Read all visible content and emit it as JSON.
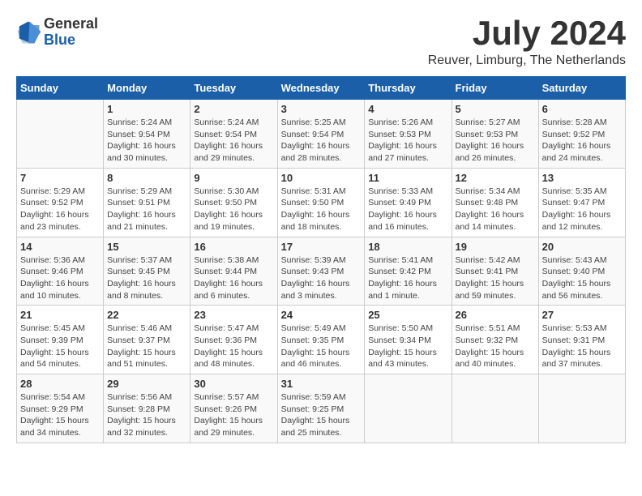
{
  "logo": {
    "general": "General",
    "blue": "Blue"
  },
  "title": {
    "month": "July 2024",
    "location": "Reuver, Limburg, The Netherlands"
  },
  "calendar": {
    "headers": [
      "Sunday",
      "Monday",
      "Tuesday",
      "Wednesday",
      "Thursday",
      "Friday",
      "Saturday"
    ],
    "weeks": [
      [
        {
          "day": "",
          "text": ""
        },
        {
          "day": "1",
          "text": "Sunrise: 5:24 AM\nSunset: 9:54 PM\nDaylight: 16 hours and 30 minutes."
        },
        {
          "day": "2",
          "text": "Sunrise: 5:24 AM\nSunset: 9:54 PM\nDaylight: 16 hours and 29 minutes."
        },
        {
          "day": "3",
          "text": "Sunrise: 5:25 AM\nSunset: 9:54 PM\nDaylight: 16 hours and 28 minutes."
        },
        {
          "day": "4",
          "text": "Sunrise: 5:26 AM\nSunset: 9:53 PM\nDaylight: 16 hours and 27 minutes."
        },
        {
          "day": "5",
          "text": "Sunrise: 5:27 AM\nSunset: 9:53 PM\nDaylight: 16 hours and 26 minutes."
        },
        {
          "day": "6",
          "text": "Sunrise: 5:28 AM\nSunset: 9:52 PM\nDaylight: 16 hours and 24 minutes."
        }
      ],
      [
        {
          "day": "7",
          "text": "Sunrise: 5:29 AM\nSunset: 9:52 PM\nDaylight: 16 hours and 23 minutes."
        },
        {
          "day": "8",
          "text": "Sunrise: 5:29 AM\nSunset: 9:51 PM\nDaylight: 16 hours and 21 minutes."
        },
        {
          "day": "9",
          "text": "Sunrise: 5:30 AM\nSunset: 9:50 PM\nDaylight: 16 hours and 19 minutes."
        },
        {
          "day": "10",
          "text": "Sunrise: 5:31 AM\nSunset: 9:50 PM\nDaylight: 16 hours and 18 minutes."
        },
        {
          "day": "11",
          "text": "Sunrise: 5:33 AM\nSunset: 9:49 PM\nDaylight: 16 hours and 16 minutes."
        },
        {
          "day": "12",
          "text": "Sunrise: 5:34 AM\nSunset: 9:48 PM\nDaylight: 16 hours and 14 minutes."
        },
        {
          "day": "13",
          "text": "Sunrise: 5:35 AM\nSunset: 9:47 PM\nDaylight: 16 hours and 12 minutes."
        }
      ],
      [
        {
          "day": "14",
          "text": "Sunrise: 5:36 AM\nSunset: 9:46 PM\nDaylight: 16 hours and 10 minutes."
        },
        {
          "day": "15",
          "text": "Sunrise: 5:37 AM\nSunset: 9:45 PM\nDaylight: 16 hours and 8 minutes."
        },
        {
          "day": "16",
          "text": "Sunrise: 5:38 AM\nSunset: 9:44 PM\nDaylight: 16 hours and 6 minutes."
        },
        {
          "day": "17",
          "text": "Sunrise: 5:39 AM\nSunset: 9:43 PM\nDaylight: 16 hours and 3 minutes."
        },
        {
          "day": "18",
          "text": "Sunrise: 5:41 AM\nSunset: 9:42 PM\nDaylight: 16 hours and 1 minute."
        },
        {
          "day": "19",
          "text": "Sunrise: 5:42 AM\nSunset: 9:41 PM\nDaylight: 15 hours and 59 minutes."
        },
        {
          "day": "20",
          "text": "Sunrise: 5:43 AM\nSunset: 9:40 PM\nDaylight: 15 hours and 56 minutes."
        }
      ],
      [
        {
          "day": "21",
          "text": "Sunrise: 5:45 AM\nSunset: 9:39 PM\nDaylight: 15 hours and 54 minutes."
        },
        {
          "day": "22",
          "text": "Sunrise: 5:46 AM\nSunset: 9:37 PM\nDaylight: 15 hours and 51 minutes."
        },
        {
          "day": "23",
          "text": "Sunrise: 5:47 AM\nSunset: 9:36 PM\nDaylight: 15 hours and 48 minutes."
        },
        {
          "day": "24",
          "text": "Sunrise: 5:49 AM\nSunset: 9:35 PM\nDaylight: 15 hours and 46 minutes."
        },
        {
          "day": "25",
          "text": "Sunrise: 5:50 AM\nSunset: 9:34 PM\nDaylight: 15 hours and 43 minutes."
        },
        {
          "day": "26",
          "text": "Sunrise: 5:51 AM\nSunset: 9:32 PM\nDaylight: 15 hours and 40 minutes."
        },
        {
          "day": "27",
          "text": "Sunrise: 5:53 AM\nSunset: 9:31 PM\nDaylight: 15 hours and 37 minutes."
        }
      ],
      [
        {
          "day": "28",
          "text": "Sunrise: 5:54 AM\nSunset: 9:29 PM\nDaylight: 15 hours and 34 minutes."
        },
        {
          "day": "29",
          "text": "Sunrise: 5:56 AM\nSunset: 9:28 PM\nDaylight: 15 hours and 32 minutes."
        },
        {
          "day": "30",
          "text": "Sunrise: 5:57 AM\nSunset: 9:26 PM\nDaylight: 15 hours and 29 minutes."
        },
        {
          "day": "31",
          "text": "Sunrise: 5:59 AM\nSunset: 9:25 PM\nDaylight: 15 hours and 25 minutes."
        },
        {
          "day": "",
          "text": ""
        },
        {
          "day": "",
          "text": ""
        },
        {
          "day": "",
          "text": ""
        }
      ]
    ]
  }
}
